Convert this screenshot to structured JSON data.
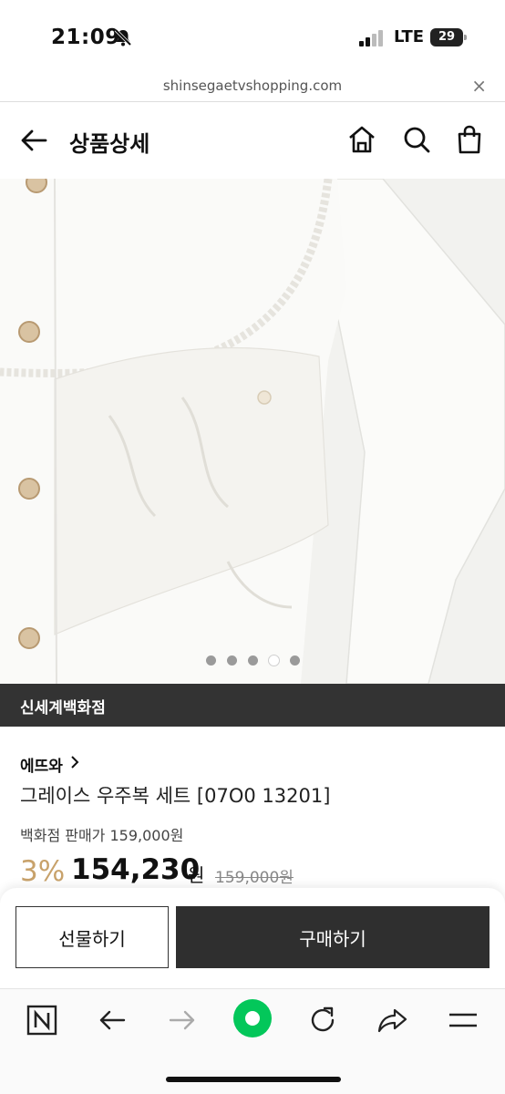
{
  "status_bar": {
    "time": "21:09",
    "network": "LTE",
    "battery": "29"
  },
  "url_bar": {
    "url": "shinsegaetvshopping.com",
    "close_label": "×"
  },
  "header": {
    "title": "상품상세"
  },
  "gallery": {
    "total_images": 5,
    "active_index": 4
  },
  "department": {
    "label": "신세계백화점"
  },
  "product": {
    "brand": "에뜨와",
    "name": "그레이스 우주복 세트 [07O0 13201]",
    "dept_price_text": "백화점 판매가 159,000원",
    "discount": "3%",
    "sale_price": "154,230",
    "sale_unit": "원",
    "original_price": "159,000원"
  },
  "actions": {
    "gift_label": "선물하기",
    "buy_label": "구매하기"
  },
  "colors": {
    "accent_discount": "#c8a26b",
    "dark_bar": "#333333",
    "buy_button": "#2f2f2f",
    "browser_green": "#03c75a"
  },
  "browser_toolbar": {
    "icons": [
      "naver-n-icon",
      "back-arrow-icon",
      "forward-arrow-icon",
      "green-home-icon",
      "reload-icon",
      "share-icon",
      "menu-icon"
    ]
  }
}
